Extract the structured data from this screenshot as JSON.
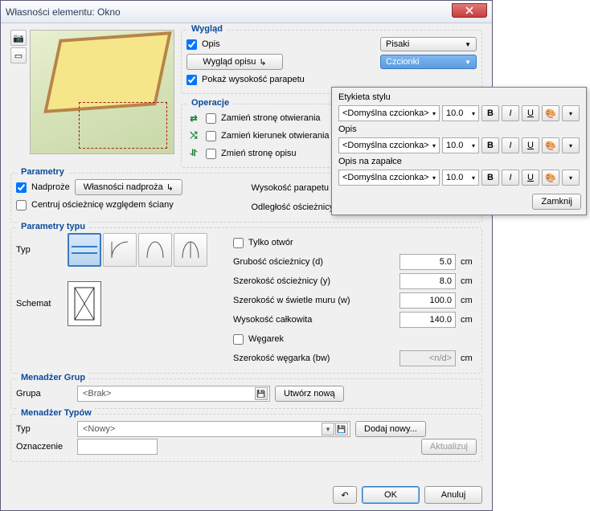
{
  "title": "Własności elementu: Okno",
  "wyglad": {
    "legend": "Wygląd",
    "opis_cb_label": "Opis",
    "pisaki": "Pisaki",
    "czcionki": "Czcionki",
    "wyglad_opisu": "Wygląd opisu",
    "pokaz_wys": "Pokaż wysokość parapetu"
  },
  "operacje": {
    "legend": "Operacje",
    "zamien_strone": "Zamień stronę otwierania",
    "zamien_kierunek": "Zamień kierunek otwierania",
    "zmien_strone_opisu": "Zmień stronę opisu"
  },
  "parametry": {
    "legend": "Parametry",
    "nadproze": "Nadproże",
    "wlas_nadproza": "Własności nadproża",
    "centruj": "Centruj ościeżnicę względem ściany",
    "wys_parapetu": "Wysokość parapetu",
    "odl_osc": "Odległość ościeżnicy od krawędzi ściany (x)"
  },
  "parametry_typu": {
    "legend": "Parametry typu",
    "typ": "Typ",
    "schemat": "Schemat",
    "tylko_otwor": "Tylko otwór",
    "grubosc": "Grubość ościeżnicy (d)",
    "grubosc_v": "5.0",
    "szer_osc": "Szerokość ościeżnicy (y)",
    "szer_osc_v": "8.0",
    "szer_swiatle": "Szerokość w świetle muru (w)",
    "szer_swiatle_v": "100.0",
    "wys_calk": "Wysokość całkowita",
    "wys_calk_v": "140.0",
    "wegarek": "Węgarek",
    "szer_weg": "Szerokość węgarka (bw)",
    "szer_weg_v": "<n/d>",
    "unit": "cm"
  },
  "grupy": {
    "legend": "Menadżer Grup",
    "grupa": "Grupa",
    "grupa_v": "<Brak>",
    "utworz": "Utwórz nową"
  },
  "typy": {
    "legend": "Menadżer Typów",
    "typ": "Typ",
    "typ_v": "<Nowy>",
    "dodaj": "Dodaj nowy...",
    "oznaczenie": "Oznaczenie",
    "aktualizuj": "Aktualizuj"
  },
  "footer": {
    "ok": "OK",
    "anuluj": "Anuluj"
  },
  "font_panel": {
    "etykieta": "Etykieta stylu",
    "opis": "Opis",
    "opis_zapalka": "Opis na zapałce",
    "font": "<Domyślna czcionka>",
    "size": "10.0",
    "bold": "B",
    "italic": "I",
    "underline": "U",
    "zamknij": "Zamknij"
  }
}
